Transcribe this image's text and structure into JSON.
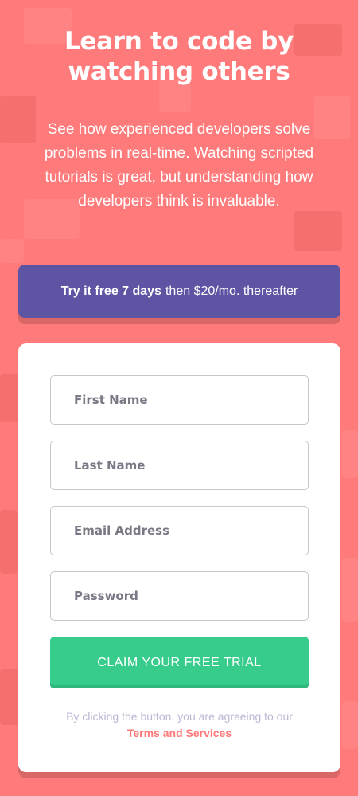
{
  "hero": {
    "title": "Learn to code by watching others",
    "description": "See how experienced developers solve problems in real-time. Watching scripted tutorials is great, but understanding how developers think is invaluable."
  },
  "promo": {
    "bold": "Try it free 7 days",
    "rest": "then $20/mo. thereafter"
  },
  "form": {
    "first_name_placeholder": "First Name",
    "last_name_placeholder": "Last Name",
    "email_placeholder": "Email Address",
    "password_placeholder": "Password",
    "submit_label": "CLAIM YOUR FREE TRIAL",
    "terms_text": "By clicking the button, you are agreeing to our",
    "terms_link": "Terms and Services"
  },
  "colors": {
    "background": "#ff7a7a",
    "promo": "#5e54a4",
    "submit": "#38cc8c",
    "terms_link": "#ff7a7a"
  }
}
